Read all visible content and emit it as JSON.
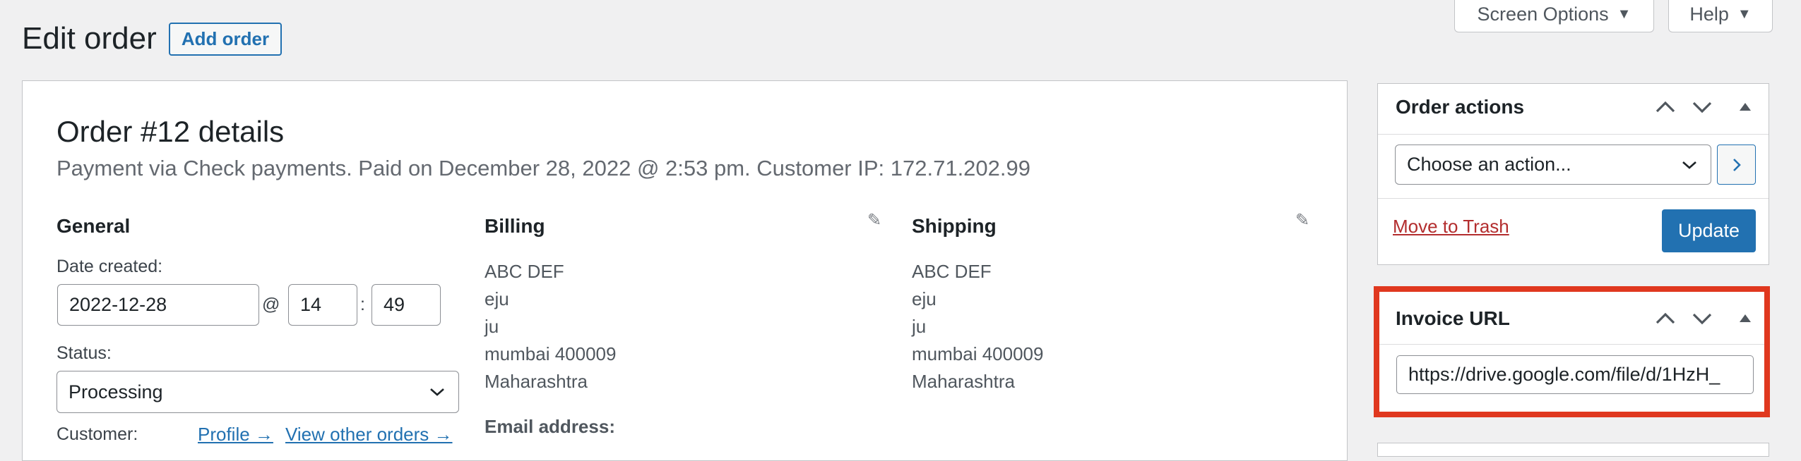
{
  "header": {
    "screen_options": "Screen Options",
    "help": "Help",
    "title": "Edit order",
    "add_order": "Add order"
  },
  "order": {
    "heading": "Order #12 details",
    "meta": "Payment via Check payments. Paid on December 28, 2022 @ 2:53 pm. Customer IP: 172.71.202.99"
  },
  "general": {
    "heading": "General",
    "date_label": "Date created:",
    "date_value": "2022-12-28",
    "at": "@",
    "hour": "14",
    "colon": ":",
    "minute": "49",
    "status_label": "Status:",
    "status_value": "Processing",
    "customer_label": "Customer:",
    "profile_link": "Profile →",
    "other_orders_link": "View other orders →"
  },
  "billing": {
    "heading": "Billing",
    "lines": [
      "ABC DEF",
      "eju",
      "ju",
      "mumbai 400009",
      "Maharashtra"
    ],
    "email_label": "Email address:"
  },
  "shipping": {
    "heading": "Shipping",
    "lines": [
      "ABC DEF",
      "eju",
      "ju",
      "mumbai 400009",
      "Maharashtra"
    ]
  },
  "order_actions": {
    "title": "Order actions",
    "select_value": "Choose an action...",
    "trash": "Move to Trash",
    "update": "Update"
  },
  "invoice": {
    "title": "Invoice URL",
    "url": "https://drive.google.com/file/d/1HzH_"
  },
  "colors": {
    "accent": "#2271b1",
    "highlight": "#e0381f",
    "trash": "#b32d2e"
  },
  "icons": [
    "chevron-up-icon",
    "chevron-down-icon",
    "toggle-triangle-icon",
    "pencil-icon",
    "caret-down-icon",
    "chevron-right-icon"
  ]
}
